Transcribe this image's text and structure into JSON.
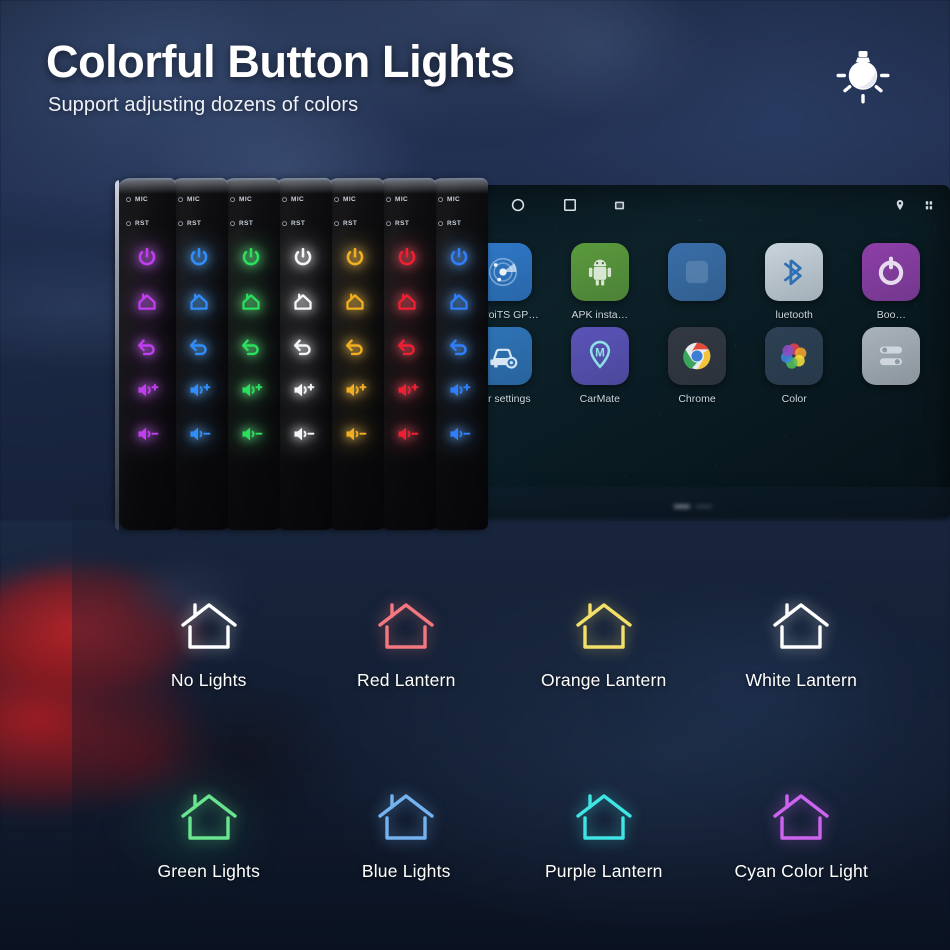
{
  "header": {
    "title": "Colorful Button Lights",
    "subtitle": "Support adjusting dozens of colors",
    "bulb_icon": "light-bulb-icon"
  },
  "colors": {
    "background_top": "#1c2740",
    "background_bottom": "#0a1220",
    "text_primary": "#ffffff",
    "car_red": "#bc2428"
  },
  "button_panels": {
    "mic_label": "MIC",
    "rst_label": "RST",
    "buttons": [
      "power-icon",
      "home-icon",
      "back-icon",
      "volume-up-icon",
      "volume-down-icon"
    ],
    "panels": [
      {
        "color": "#c13ef0",
        "glow": "#d36bff",
        "name": "purple"
      },
      {
        "color": "#2f8dfc",
        "glow": "#63b2ff",
        "name": "blue"
      },
      {
        "color": "#2ae05c",
        "glow": "#6dff93",
        "name": "green"
      },
      {
        "color": "#f2f6fb",
        "glow": "#ffffff",
        "name": "white"
      },
      {
        "color": "#f0ae20",
        "glow": "#ffcb57",
        "name": "orange"
      },
      {
        "color": "#f01f32",
        "glow": "#ff5c6b",
        "name": "red"
      },
      {
        "color": "#2f7ffc",
        "glow": "#67adff",
        "name": "blue2"
      }
    ]
  },
  "screen": {
    "nav_icons": [
      "back-triangle-icon",
      "home-circle-icon",
      "recents-square-icon",
      "screenshot-icon"
    ],
    "status_icons": [
      "location-pin-icon",
      "signal-icon"
    ],
    "apps": [
      {
        "label": "AndroiTS GP…",
        "icon": "gps-radar-icon",
        "bg": "#2f78c8"
      },
      {
        "label": "APK insta…",
        "icon": "android-robot-icon",
        "bg": "#5b9a3c"
      },
      {
        "label": "",
        "icon": "hidden-icon",
        "bg": "#3a6ea8"
      },
      {
        "label": "luetooth",
        "icon": "bluetooth-icon",
        "bg": "#c9d4dd"
      },
      {
        "label": "Boo…",
        "icon": "boost-ring-icon",
        "bg": "#8d3fa8"
      },
      {
        "label": "Car settings",
        "icon": "car-gear-icon",
        "bg": "#2f74b8"
      },
      {
        "label": "CarMate",
        "icon": "carmate-pin-icon",
        "bg": "#5b53b8"
      },
      {
        "label": "Chrome",
        "icon": "chrome-icon",
        "bg": "#333842"
      },
      {
        "label": "Color",
        "icon": "color-petals-icon",
        "bg": "#2e4154"
      },
      {
        "label": "",
        "icon": "toggle-icon",
        "bg": "#aab3bc"
      }
    ],
    "page_dots": 2,
    "active_dot": 1,
    "color_picker": {
      "name": "color-wheel-picker",
      "center_color": "#ffffff"
    }
  },
  "lanterns": [
    {
      "label": "No Lights",
      "color": "#ffffff",
      "glow": "rgba(255,255,255,0.55)"
    },
    {
      "label": "Red Lantern",
      "color": "#f4787f",
      "glow": "rgba(244,120,127,0.6)"
    },
    {
      "label": "Orange Lantern",
      "color": "#f2e06a",
      "glow": "rgba(242,224,106,0.6)"
    },
    {
      "label": "White Lantern",
      "color": "#ffffff",
      "glow": "rgba(255,255,255,0.55)"
    },
    {
      "label": "Green Lights",
      "color": "#69e48f",
      "glow": "rgba(105,228,143,0.6)"
    },
    {
      "label": "Blue Lights",
      "color": "#74b2f0",
      "glow": "rgba(116,178,240,0.6)"
    },
    {
      "label": "Purple Lantern",
      "color": "#3fe4e4",
      "glow": "rgba(63,228,228,0.6)"
    },
    {
      "label": "Cyan Color Light",
      "color": "#cd64ef",
      "glow": "rgba(205,100,239,0.6)"
    }
  ]
}
